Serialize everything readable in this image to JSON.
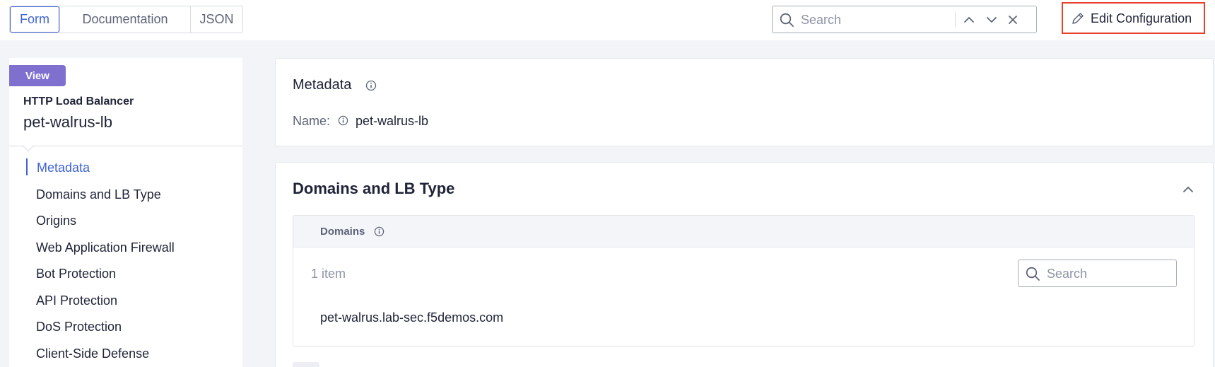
{
  "tabs": [
    {
      "label": "Form",
      "active": true
    },
    {
      "label": "Documentation",
      "active": false
    },
    {
      "label": "JSON",
      "active": false
    }
  ],
  "top_search": {
    "placeholder": "Search"
  },
  "edit_button": {
    "label": "Edit Configuration",
    "icon": "pencil-icon",
    "highlight_color": "#e8402b"
  },
  "sidebar": {
    "badge": "View",
    "badge_color": "#7f6fce",
    "object_type": "HTTP Load Balancer",
    "object_name": "pet-walrus-lb",
    "items": [
      {
        "label": "Metadata",
        "active": true
      },
      {
        "label": "Domains and LB Type",
        "active": false
      },
      {
        "label": "Origins",
        "active": false
      },
      {
        "label": "Web Application Firewall",
        "active": false
      },
      {
        "label": "Bot Protection",
        "active": false
      },
      {
        "label": "API Protection",
        "active": false
      },
      {
        "label": "DoS Protection",
        "active": false
      },
      {
        "label": "Client-Side Defense",
        "active": false
      }
    ]
  },
  "metadata_card": {
    "title": "Metadata",
    "name_label": "Name:",
    "name_value": "pet-walrus-lb"
  },
  "domains_card": {
    "title": "Domains and LB Type",
    "domains_header": "Domains",
    "item_count": "1 item",
    "search_placeholder": "Search",
    "domains": [
      "pet-walrus.lab-sec.f5demos.com"
    ]
  },
  "colors": {
    "accent": "#3f63d3",
    "text": "#1f2337",
    "muted": "#5d6378"
  }
}
